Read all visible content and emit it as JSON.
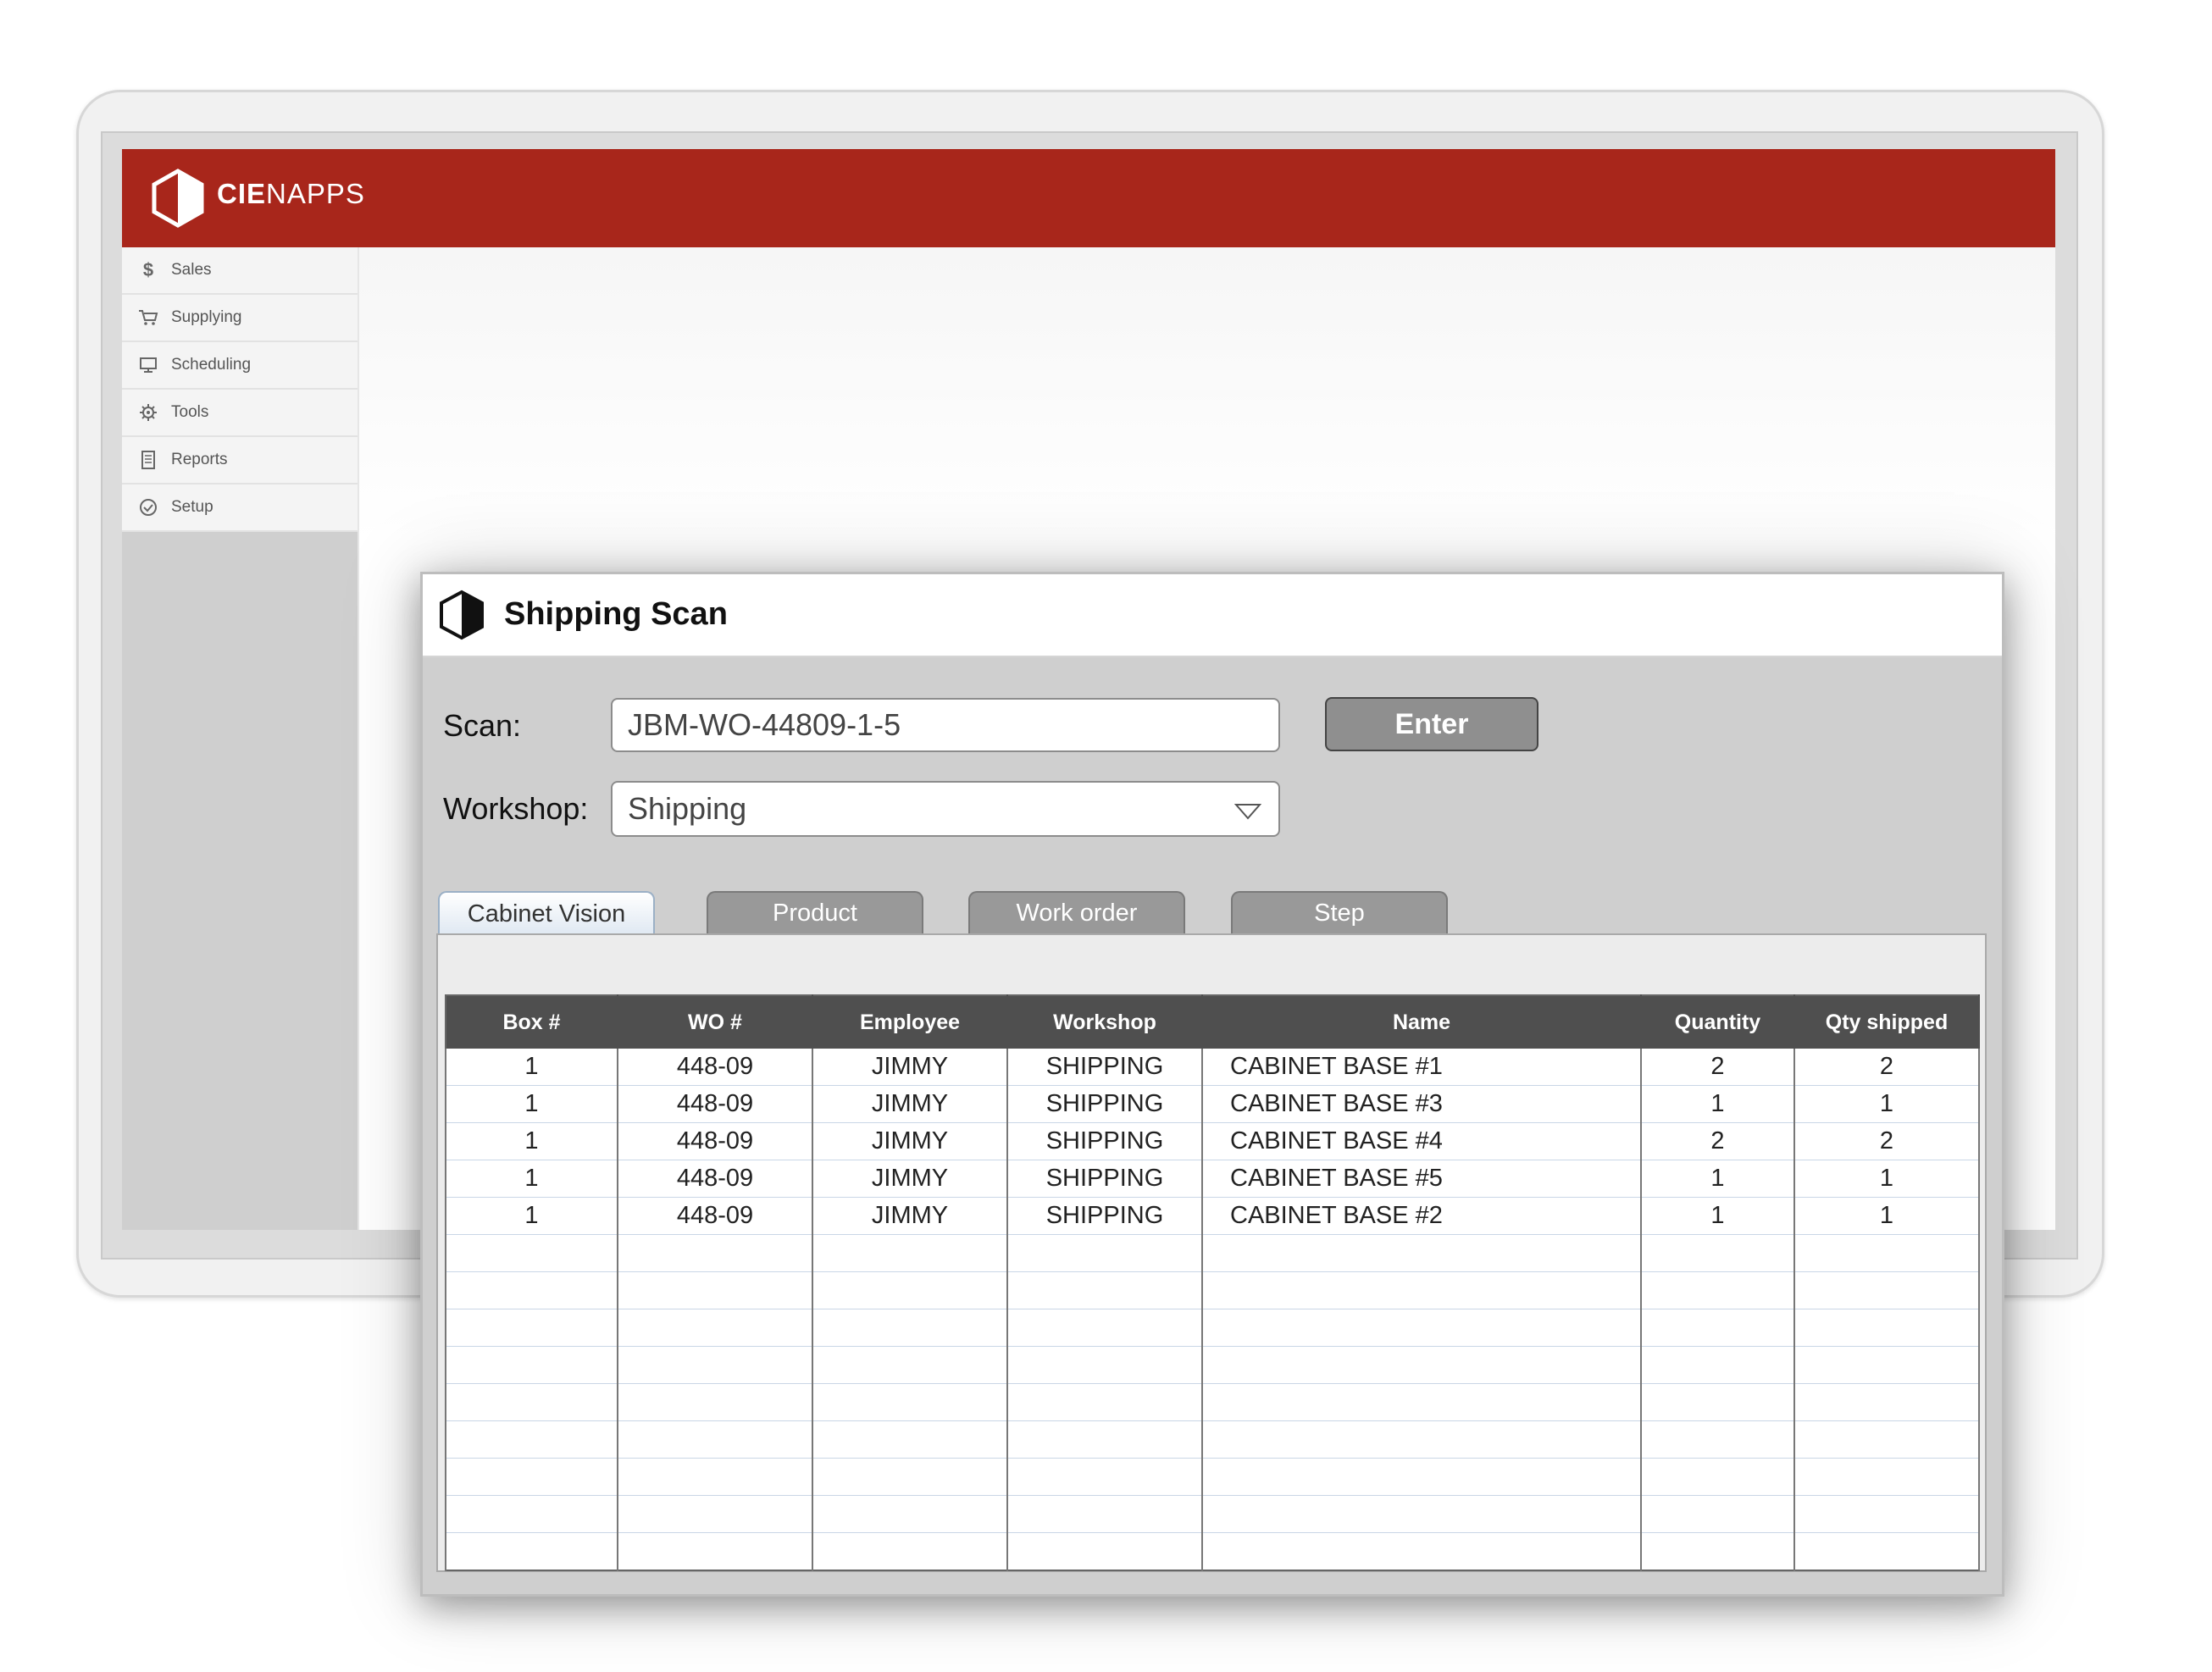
{
  "app": {
    "brand_bold": "CIE",
    "brand_light": "NAPPS",
    "colors": {
      "header": "#a8261b",
      "sidebar": "#f4f4f4",
      "table_header": "#4f4f4f"
    }
  },
  "sidebar": {
    "items": [
      {
        "label": "Sales",
        "icon": "dollar-icon"
      },
      {
        "label": "Supplying",
        "icon": "cart-icon"
      },
      {
        "label": "Scheduling",
        "icon": "monitor-icon"
      },
      {
        "label": "Tools",
        "icon": "gear-icon"
      },
      {
        "label": "Reports",
        "icon": "document-icon"
      },
      {
        "label": "Setup",
        "icon": "check-circle-icon"
      }
    ]
  },
  "dialog": {
    "title": "Shipping Scan",
    "scan_label": "Scan:",
    "scan_value": "JBM-WO-44809-1-5",
    "enter_label": "Enter",
    "workshop_label": "Workshop:",
    "workshop_value": "Shipping",
    "tabs": [
      {
        "label": "Cabinet Vision",
        "active": true
      },
      {
        "label": "Product",
        "active": false
      },
      {
        "label": "Work order",
        "active": false
      },
      {
        "label": "Step",
        "active": false
      }
    ]
  },
  "table": {
    "columns": [
      "Box #",
      "WO #",
      "Employee",
      "Workshop",
      "Name",
      "Quantity",
      "Qty shipped"
    ],
    "rows": [
      [
        "1",
        "448-09",
        "JIMMY",
        "SHIPPING",
        "CABINET BASE #1",
        "2",
        "2"
      ],
      [
        "1",
        "448-09",
        "JIMMY",
        "SHIPPING",
        "CABINET BASE #3",
        "1",
        "1"
      ],
      [
        "1",
        "448-09",
        "JIMMY",
        "SHIPPING",
        "CABINET BASE #4",
        "2",
        "2"
      ],
      [
        "1",
        "448-09",
        "JIMMY",
        "SHIPPING",
        "CABINET BASE #5",
        "1",
        "1"
      ],
      [
        "1",
        "448-09",
        "JIMMY",
        "SHIPPING",
        "CABINET BASE #2",
        "1",
        "1"
      ]
    ]
  }
}
